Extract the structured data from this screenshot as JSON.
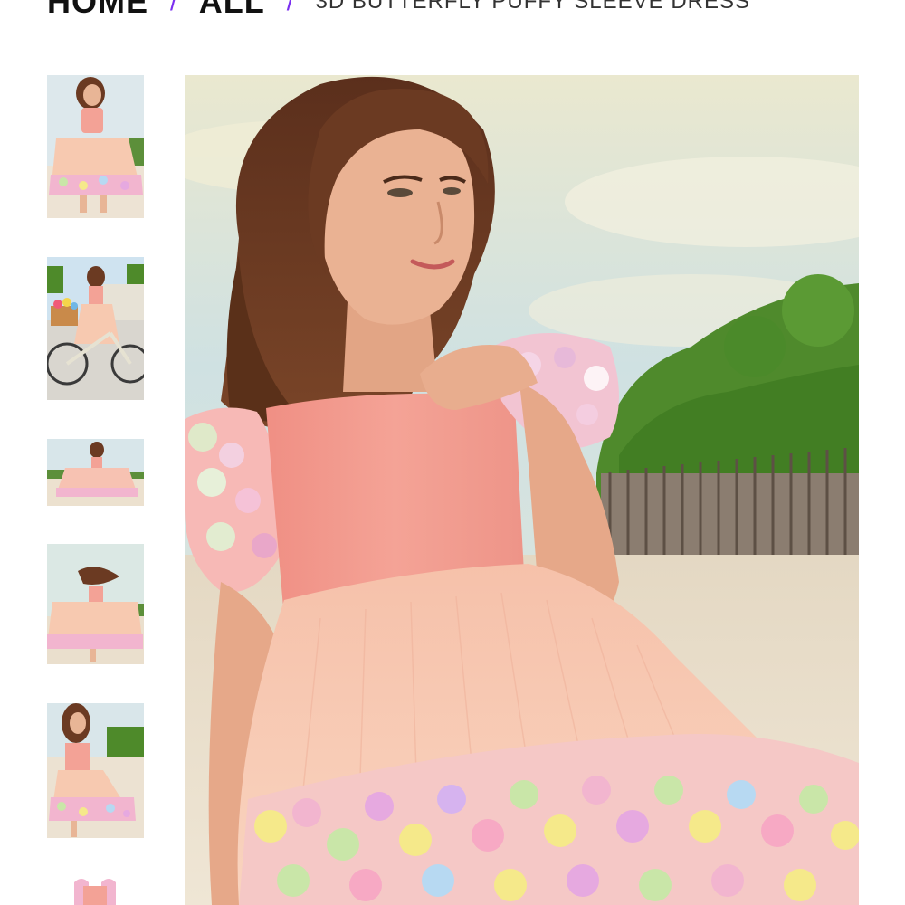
{
  "breadcrumb": {
    "home_label": "HOME",
    "all_label": "ALL",
    "separator": "/",
    "current_label": "3D BUTTERFLY PUFFY SLEEVE DRESS"
  },
  "colors": {
    "accent": "#7b2ff0",
    "text_dark": "#111111",
    "dress_pink": "#f3a296",
    "tulle": "#f7c9b0",
    "sky": "#cfe1e2",
    "foliage": "#4f8a2c",
    "sand": "#e9ddc8",
    "hair": "#6b3a22"
  },
  "gallery": {
    "thumbnails": [
      {
        "name": "thumb-standing-front",
        "selected": true
      },
      {
        "name": "thumb-bicycle"
      },
      {
        "name": "thumb-spin-wide"
      },
      {
        "name": "thumb-spin-hair"
      },
      {
        "name": "thumb-side-pose"
      },
      {
        "name": "thumb-flat-lay"
      }
    ]
  }
}
